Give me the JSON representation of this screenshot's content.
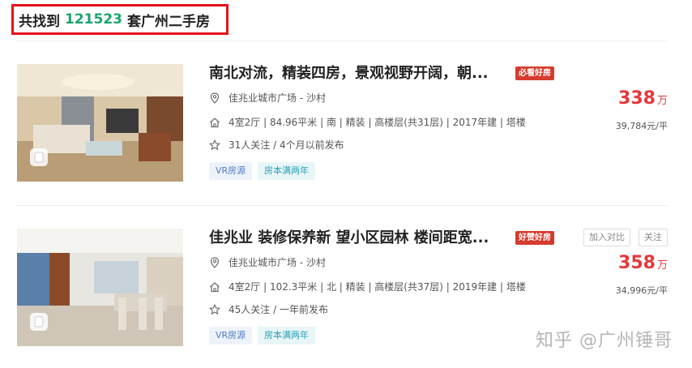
{
  "header": {
    "prefix": "共找到",
    "count": "121523",
    "suffix": "套广州二手房"
  },
  "listings": [
    {
      "title": "南北对流，精装四房，景观视野开阔，朝...",
      "tag": "必看好房",
      "community": "佳兆业城市广场 - 沙村",
      "details": "4室2厅 | 84.96平米 | 南 | 精装 | 高楼层(共31层) | 2017年建 | 塔楼",
      "followers": "31人关注 / 4个月以前发布",
      "chips": [
        "VR房源",
        "房本满两年"
      ],
      "price": "338",
      "price_unit": "万",
      "unit_price": "39,784元/平"
    },
    {
      "title": "佳兆业 装修保养新 望小区园林 楼间距宽...",
      "tag": "好赞好房",
      "community": "佳兆业城市广场 - 沙村",
      "details": "4室2厅 | 102.3平米 | 北 | 精装 | 高楼层(共37层) | 2019年建 | 塔楼",
      "followers": "45人关注 / 一年前发布",
      "chips": [
        "VR房源",
        "房本满两年"
      ],
      "price": "358",
      "price_unit": "万",
      "unit_price": "34,996元/平",
      "actions": [
        "加入对比",
        "关注"
      ]
    }
  ],
  "watermark": "知乎 @广州锤哥",
  "colors": {
    "price": "#e4393c",
    "highlight": "#1aa56b",
    "border": "#e4151b",
    "tag": "#d63b2f"
  }
}
